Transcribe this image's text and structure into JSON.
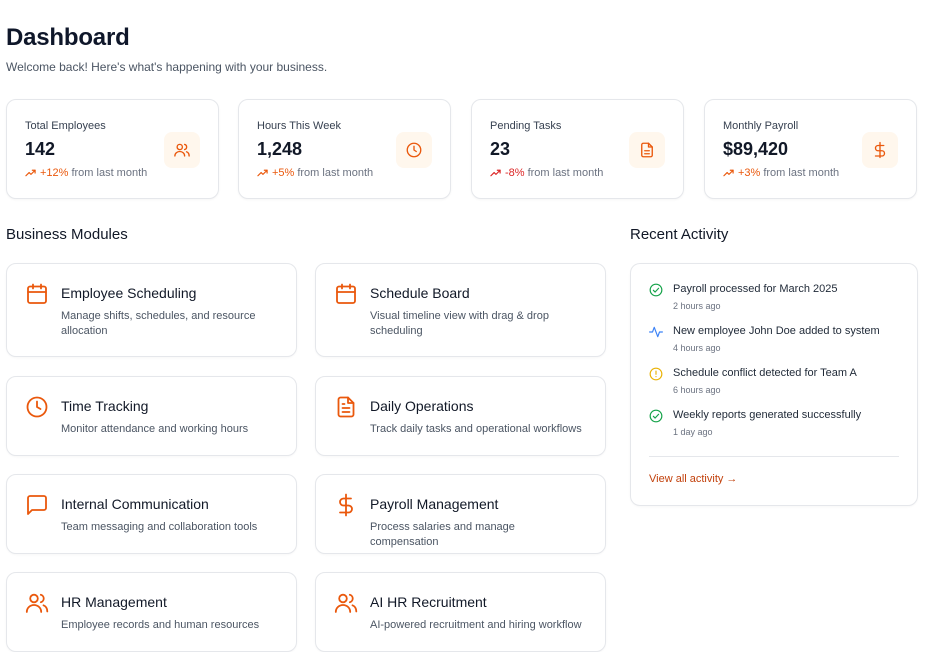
{
  "header": {
    "title": "Dashboard",
    "subtitle": "Welcome back! Here's what's happening with your business."
  },
  "stats": [
    {
      "label": "Total Employees",
      "value": "142",
      "change": "+12%",
      "suffix": "from last month",
      "trend": "up",
      "icon": "users-icon"
    },
    {
      "label": "Hours This Week",
      "value": "1,248",
      "change": "+5%",
      "suffix": "from last month",
      "trend": "up",
      "icon": "clock-icon"
    },
    {
      "label": "Pending Tasks",
      "value": "23",
      "change": "-8%",
      "suffix": "from last month",
      "trend": "down",
      "icon": "document-icon"
    },
    {
      "label": "Monthly Payroll",
      "value": "$89,420",
      "change": "+3%",
      "suffix": "from last month",
      "trend": "up",
      "icon": "dollar-icon"
    }
  ],
  "modules": {
    "title": "Business Modules",
    "items": [
      {
        "title": "Employee Scheduling",
        "desc": "Manage shifts, schedules, and resource allocation",
        "icon": "calendar-icon"
      },
      {
        "title": "Schedule Board",
        "desc": "Visual timeline view with drag & drop scheduling",
        "icon": "calendar-icon"
      },
      {
        "title": "Time Tracking",
        "desc": "Monitor attendance and working hours",
        "icon": "clock-icon"
      },
      {
        "title": "Daily Operations",
        "desc": "Track daily tasks and operational workflows",
        "icon": "document-icon"
      },
      {
        "title": "Internal Communication",
        "desc": "Team messaging and collaboration tools",
        "icon": "message-icon"
      },
      {
        "title": "Payroll Management",
        "desc": "Process salaries and manage compensation",
        "icon": "dollar-icon"
      },
      {
        "title": "HR Management",
        "desc": "Employee records and human resources",
        "icon": "users-icon"
      },
      {
        "title": "AI HR Recruitment",
        "desc": "AI-powered recruitment and hiring workflow",
        "icon": "users-icon"
      }
    ]
  },
  "activity": {
    "title": "Recent Activity",
    "items": [
      {
        "text": "Payroll processed for March 2025",
        "time": "2 hours ago",
        "icon": "check-circle-icon"
      },
      {
        "text": "New employee John Doe added to system",
        "time": "4 hours ago",
        "icon": "pulse-icon"
      },
      {
        "text": "Schedule conflict detected for Team A",
        "time": "6 hours ago",
        "icon": "alert-circle-icon"
      },
      {
        "text": "Weekly reports generated successfully",
        "time": "1 day ago",
        "icon": "check-circle-icon"
      }
    ],
    "link": "View all activity →"
  },
  "colors": {
    "accent": "#ea580c",
    "accent_bg": "#fff7ed",
    "negative": "#dc2626",
    "success": "#16a34a",
    "info": "#3b82f6",
    "warning": "#eab308"
  }
}
